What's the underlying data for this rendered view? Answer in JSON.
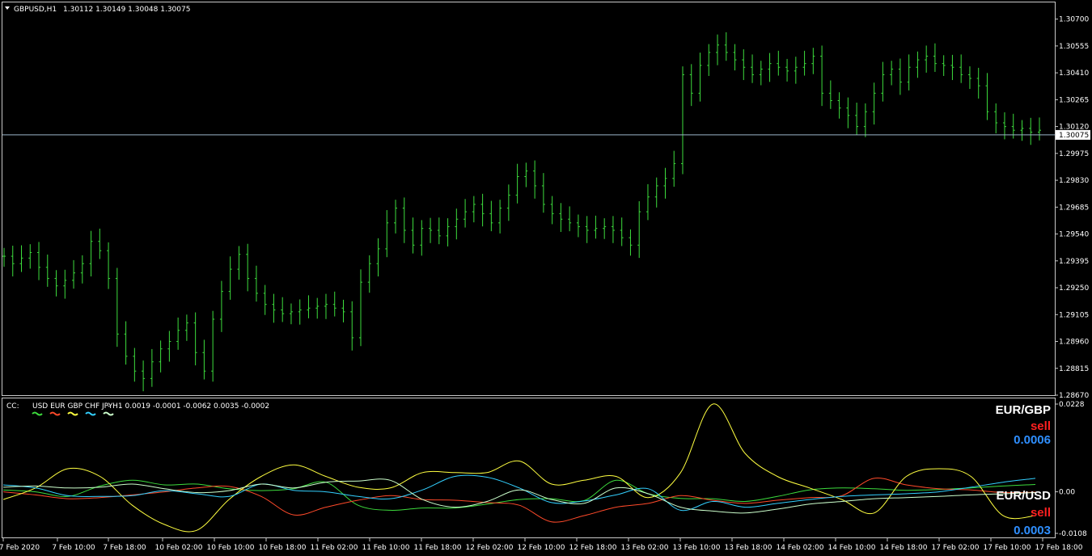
{
  "header": {
    "symbol": "GBPUSD,H1",
    "ohlc": "1.30112 1.30149 1.30048 1.30075"
  },
  "chart_data": [
    {
      "type": "ohlc",
      "symbol": "GBPUSD",
      "timeframe": "H1",
      "bar_color": "#3ddc3d",
      "ylim": [
        1.2867,
        1.3079
      ],
      "y_ticks": [
        "1.30700",
        "1.30555",
        "1.30410",
        "1.30265",
        "1.30120",
        "1.29975",
        "1.29830",
        "1.29685",
        "1.29540",
        "1.29395",
        "1.29250",
        "1.29105",
        "1.28960",
        "1.28815",
        "1.28670"
      ],
      "current_price": "1.30075",
      "current_line_color": "#9bb5c9",
      "x_ticks": [
        "7 Feb 2020",
        "7 Feb 10:00",
        "7 Feb 18:00",
        "10 Feb 02:00",
        "10 Feb 10:00",
        "10 Feb 18:00",
        "11 Feb 02:00",
        "11 Feb 10:00",
        "11 Feb 18:00",
        "12 Feb 02:00",
        "12 Feb 10:00",
        "12 Feb 18:00",
        "13 Feb 02:00",
        "13 Feb 10:00",
        "13 Feb 18:00",
        "14 Feb 02:00",
        "14 Feb 10:00",
        "14 Feb 18:00",
        "17 Feb 02:00",
        "17 Feb 10:00",
        "17 Feb 18:00"
      ],
      "closes": [
        1.2942,
        1.2938,
        1.2941,
        1.2944,
        1.2936,
        1.293,
        1.2926,
        1.2929,
        1.2933,
        1.2938,
        1.295,
        1.2945,
        1.293,
        1.29,
        1.2888,
        1.288,
        1.2876,
        1.2885,
        1.2892,
        1.2896,
        1.2902,
        1.2906,
        1.289,
        1.288,
        1.2908,
        1.2923,
        1.2935,
        1.2943,
        1.293,
        1.2922,
        1.2916,
        1.2913,
        1.2911,
        1.2912,
        1.2913,
        1.2914,
        1.2915,
        1.2916,
        1.2914,
        1.2912,
        1.2898,
        1.2928,
        1.2938,
        1.2946,
        1.296,
        1.2968,
        1.2956,
        1.2948,
        1.2957,
        1.2956,
        1.2953,
        1.2958,
        1.2962,
        1.2966,
        1.297,
        1.2965,
        1.296,
        1.2968,
        1.2975,
        1.2985,
        1.2988,
        1.298,
        1.297,
        1.2965,
        1.2962,
        1.296,
        1.2958,
        1.2956,
        1.2957,
        1.2958,
        1.2956,
        1.2952,
        1.2948,
        1.2966,
        1.2974,
        1.298,
        1.2984,
        1.2992,
        1.304,
        1.303,
        1.3045,
        1.3052,
        1.3056,
        1.3052,
        1.3048,
        1.3044,
        1.304,
        1.3043,
        1.3046,
        1.3044,
        1.3042,
        1.3044,
        1.3046,
        1.305,
        1.303,
        1.3026,
        1.3022,
        1.3018,
        1.3012,
        1.302,
        1.303,
        1.304,
        1.3043,
        1.3036,
        1.3044,
        1.3048,
        1.305,
        1.3046,
        1.3045,
        1.3044,
        1.304,
        1.3038,
        1.3034,
        1.302,
        1.3014,
        1.3012,
        1.301,
        1.3011,
        1.3009,
        1.301
      ]
    },
    {
      "type": "line",
      "indicator": "CC",
      "timeframe": "H1",
      "ylim": [
        -0.0108,
        0.0228
      ],
      "y_ticks": [
        "0.0228",
        "0.00",
        "-0.0108"
      ],
      "x_ticks": [
        "7 Feb 2020",
        "7 Feb 10:00",
        "7 Feb 18:00",
        "10 Feb 02:00",
        "10 Feb 10:00",
        "10 Feb 18:00",
        "11 Feb 02:00",
        "11 Feb 10:00",
        "11 Feb 18:00",
        "12 Feb 02:00",
        "12 Feb 10:00",
        "12 Feb 18:00",
        "13 Feb 02:00",
        "13 Feb 10:00",
        "13 Feb 18:00",
        "14 Feb 02:00",
        "14 Feb 10:00",
        "14 Feb 18:00",
        "17 Feb 02:00",
        "17 Feb 10:00",
        "17 Feb 18:00"
      ],
      "values_label": "0.0019 -0.0001 -0.0062 0.0035 -0.0002",
      "series": [
        {
          "name": "USD",
          "color": "#3ddc3d",
          "values": [
            0.0005,
            0.0,
            -0.0012,
            0.0015,
            0.003,
            0.0018,
            0.002,
            0.0008,
            0.0003,
            0.0008,
            0.0025,
            -0.0035,
            -0.0048,
            -0.0042,
            -0.0042,
            -0.0032,
            -0.002,
            -0.0018,
            -0.0023,
            0.003,
            -0.0005,
            -0.0017,
            -0.0018,
            -0.0025,
            -0.0012,
            0.0005,
            0.001,
            0.0008,
            0.0004,
            0.0006,
            0.001,
            0.0015,
            0.0019
          ]
        },
        {
          "name": "EUR",
          "color": "#ff4a2a",
          "values": [
            0.0,
            -0.0008,
            -0.0018,
            -0.0015,
            -0.0008,
            0.0,
            0.001,
            0.0014,
            -0.0012,
            -0.006,
            -0.004,
            -0.0022,
            -0.001,
            -0.002,
            -0.0022,
            -0.0028,
            -0.0035,
            -0.0078,
            -0.0062,
            -0.004,
            -0.003,
            -0.001,
            -0.0022,
            -0.003,
            -0.0022,
            -0.0015,
            -0.001,
            0.0035,
            0.0018,
            0.0008,
            0.0005,
            -0.0002,
            -0.0001
          ]
        },
        {
          "name": "GBP",
          "color": "#ffff40",
          "values": [
            -0.002,
            0.001,
            0.006,
            0.004,
            -0.0035,
            -0.0085,
            -0.01,
            -0.002,
            0.004,
            0.007,
            0.004,
            0.0012,
            0.001,
            0.005,
            0.005,
            0.005,
            0.008,
            0.002,
            0.003,
            0.004,
            -0.0015,
            0.005,
            0.0228,
            0.01,
            0.004,
            0.001,
            -0.002,
            -0.0055,
            0.004,
            0.006,
            0.004,
            -0.0062,
            -0.0062
          ]
        },
        {
          "name": "CHF",
          "color": "#33d0ff",
          "values": [
            0.0018,
            0.001,
            -0.001,
            -0.0012,
            -0.001,
            0.0003,
            -0.0005,
            -0.0012,
            0.002,
            0.0004,
            0.0,
            -0.0012,
            -0.0018,
            0.0005,
            0.004,
            0.0038,
            0.001,
            -0.0028,
            -0.0024,
            -0.0008,
            0.0008,
            -0.0048,
            -0.0025,
            -0.004,
            -0.003,
            -0.002,
            -0.0012,
            -0.0008,
            -0.0005,
            0.0,
            0.0012,
            0.0025,
            0.0035
          ]
        },
        {
          "name": "JPY",
          "color": "#ccffcc",
          "values": [
            0.0012,
            0.0015,
            0.001,
            0.0012,
            0.002,
            0.0008,
            -0.0002,
            0.0003,
            0.002,
            0.001,
            0.0025,
            0.0028,
            0.003,
            -0.002,
            -0.004,
            -0.0025,
            0.0005,
            -0.002,
            -0.003,
            0.001,
            -0.0005,
            -0.004,
            -0.005,
            -0.0055,
            -0.0045,
            -0.0032,
            -0.0025,
            -0.0018,
            -0.0015,
            -0.0012,
            -0.0008,
            -0.0005,
            -0.0002
          ]
        }
      ]
    }
  ],
  "indicator_header": {
    "short_name": "CC:",
    "currencies": "USD EUR GBP CHF JPY",
    "suffix": "- H1 0.0019 -0.0001 -0.0062 0.0035 -0.0002"
  },
  "signals": [
    {
      "pair": "EUR/GBP",
      "action": "sell",
      "value": "0.0006",
      "pair_color": "#ffffff",
      "action_color": "#ff2020",
      "value_color": "#2f8fff"
    },
    {
      "pair": "EUR/USD",
      "action": "sell",
      "value": "0.0003",
      "pair_color": "#ffffff",
      "action_color": "#ff2020",
      "value_color": "#2f8fff"
    }
  ]
}
